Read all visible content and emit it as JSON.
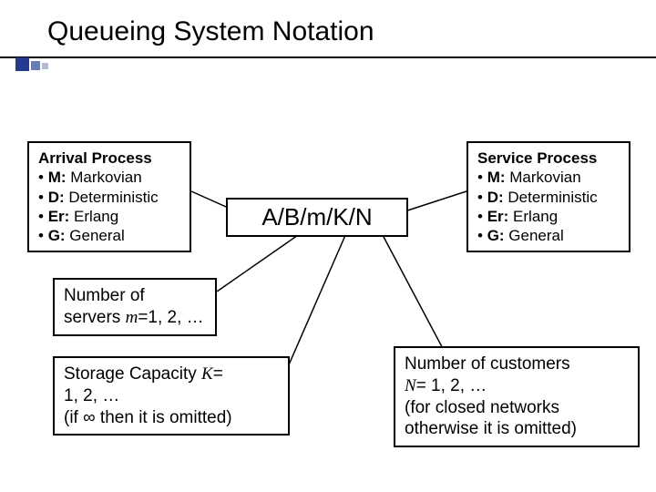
{
  "title": "Queueing System Notation",
  "center": "A/B/m/K/N",
  "arrival": {
    "heading": "Arrival Process",
    "items": [
      {
        "k": "M:",
        "v": "  Markovian"
      },
      {
        "k": "D:",
        "v": "  Deterministic"
      },
      {
        "k": "Er:",
        "v": " Erlang"
      },
      {
        "k": "G:",
        "v": "  General"
      }
    ]
  },
  "service": {
    "heading": "Service Process",
    "items": [
      {
        "k": "M:",
        "v": "  Markovian"
      },
      {
        "k": "D:",
        "v": "  Deterministic"
      },
      {
        "k": "Er:",
        "v": " Erlang"
      },
      {
        "k": "G:",
        "v": "  General"
      }
    ]
  },
  "servers": {
    "line1": "Number of",
    "line2a": "servers ",
    "line2b": "m",
    "line2c": "=1, 2, …"
  },
  "storage": {
    "line1a": "Storage Capacity ",
    "line1b": "K",
    "line1c": "=",
    "line2": "1, 2, …",
    "line3": "(if ∞ then it is omitted)"
  },
  "customers": {
    "line1": "Number of customers",
    "line2a": "N",
    "line2b": "= 1, 2, …",
    "line3": "(for closed networks",
    "line4": "otherwise it is omitted)"
  }
}
